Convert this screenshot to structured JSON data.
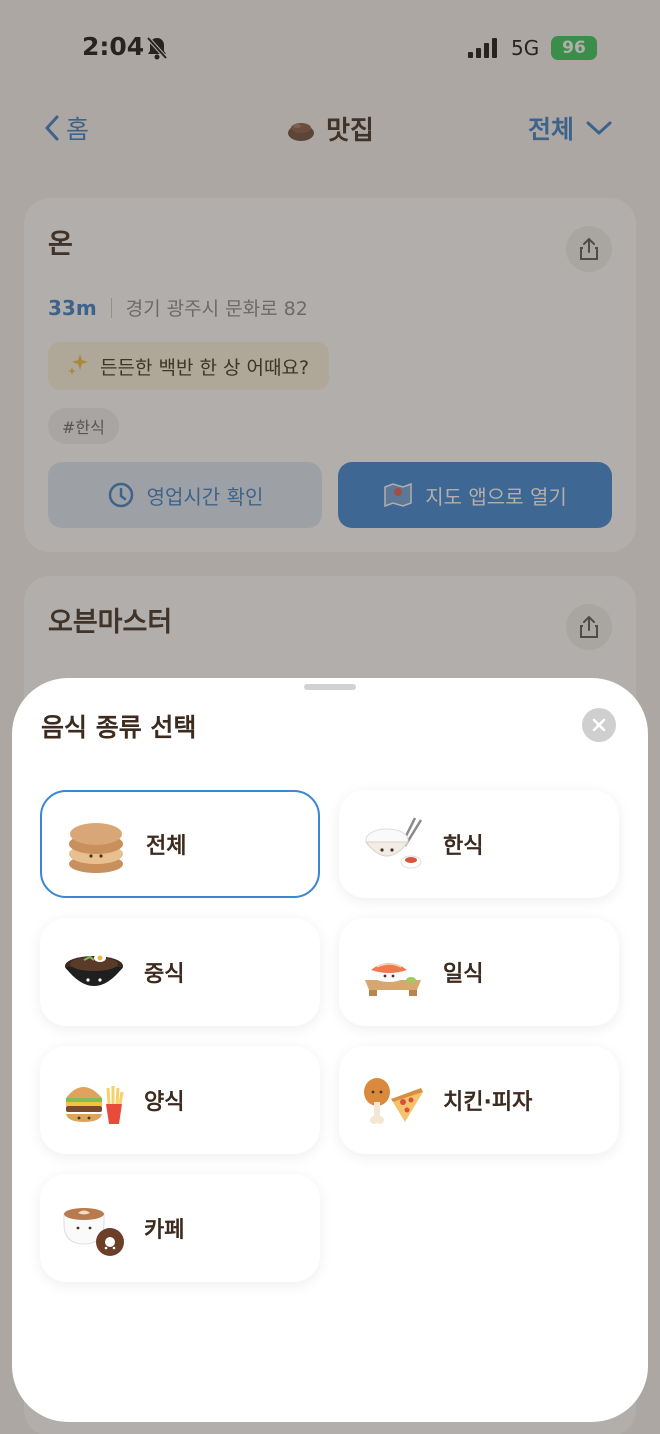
{
  "status_bar": {
    "time": "2:04",
    "network": "5G",
    "battery": "96"
  },
  "nav": {
    "back_label": "홈",
    "title": "맛집",
    "filter_label": "전체"
  },
  "cards": [
    {
      "name": "온",
      "distance": "33m",
      "address": "경기 광주시 문화로 82",
      "tip": "든든한 백반 한 상 어때요?",
      "tag": "#한식",
      "hours_button": "영업시간 확인",
      "map_button": "지도 앱으로 열기"
    },
    {
      "name": "오븐마스터"
    }
  ],
  "sheet": {
    "title": "음식 종류 선택",
    "options": [
      {
        "label": "전체",
        "icon": "pancake-stack-icon",
        "selected": true
      },
      {
        "label": "한식",
        "icon": "rice-bowl-icon",
        "selected": false
      },
      {
        "label": "중식",
        "icon": "jjajang-bowl-icon",
        "selected": false
      },
      {
        "label": "일식",
        "icon": "sushi-icon",
        "selected": false
      },
      {
        "label": "양식",
        "icon": "burger-fries-icon",
        "selected": false
      },
      {
        "label": "치킨·피자",
        "icon": "chicken-pizza-icon",
        "selected": false
      },
      {
        "label": "카페",
        "icon": "coffee-donut-icon",
        "selected": false
      }
    ]
  },
  "colors": {
    "accent": "#3a86d6",
    "text_brown": "#3d2b1f",
    "tip_bg": "#fbf3dc"
  }
}
